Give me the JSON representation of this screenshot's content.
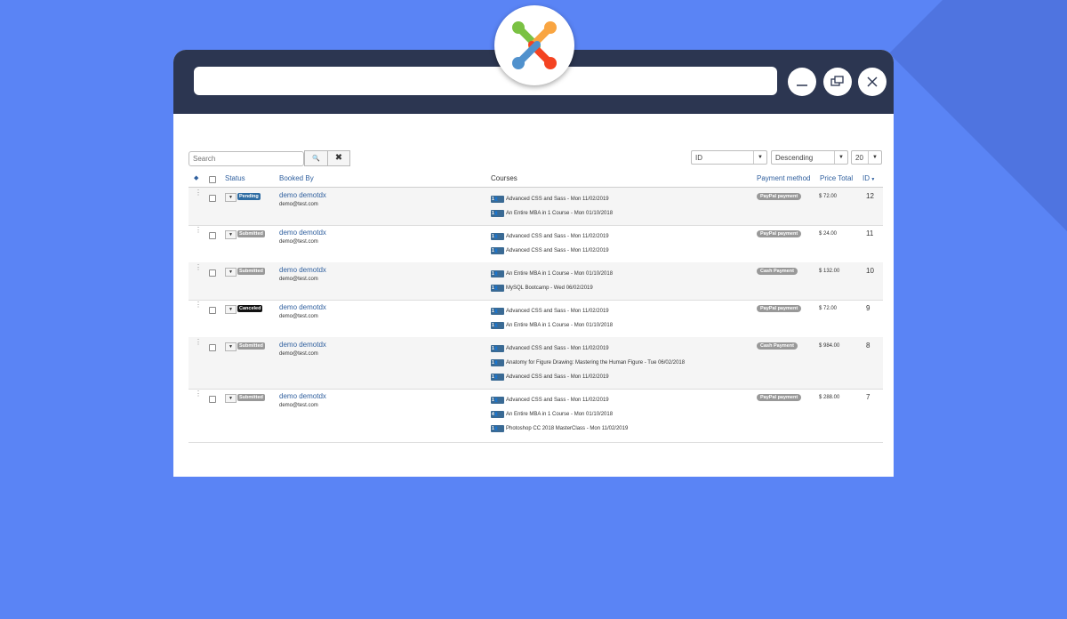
{
  "search": {
    "placeholder": "Search",
    "search_button": "🔍",
    "clear_button": "✖"
  },
  "sort": {
    "field": "ID",
    "direction": "Descending",
    "limit": "20"
  },
  "columns": {
    "status": "Status",
    "booked_by": "Booked By",
    "courses": "Courses",
    "payment_method": "Payment method",
    "price_total": "Price Total",
    "id": "ID"
  },
  "colors": {
    "pending": "#2f6da3",
    "submitted": "#999999",
    "canceled": "#111111",
    "link": "#2f5f9e",
    "titlebar": "#2c3651",
    "background": "#5a84f5"
  },
  "rows": [
    {
      "status": "Pending",
      "status_color": "#2f6da3",
      "name": "demo demotdx",
      "email": "demo@test.com",
      "courses": [
        {
          "qty": "1",
          "title": "Advanced CSS and Sass - Mon 11/02/2019"
        },
        {
          "qty": "1",
          "title": "An Entire MBA in 1 Course - Mon 01/10/2018"
        }
      ],
      "payment": "PayPal payment",
      "price": "$ 72.00",
      "id": "12"
    },
    {
      "status": "Submitted",
      "status_color": "#999999",
      "name": "demo demotdx",
      "email": "demo@test.com",
      "courses": [
        {
          "qty": "1",
          "title": "Advanced CSS and Sass - Mon 11/02/2019"
        },
        {
          "qty": "1",
          "title": "Advanced CSS and Sass - Mon 11/02/2019"
        }
      ],
      "payment": "PayPal payment",
      "price": "$ 24.00",
      "id": "11"
    },
    {
      "status": "Submitted",
      "status_color": "#999999",
      "name": "demo demotdx",
      "email": "demo@test.com",
      "courses": [
        {
          "qty": "1",
          "title": "An Entire MBA in 1 Course - Mon 01/10/2018"
        },
        {
          "qty": "1",
          "title": "MySQL Bootcamp - Wed 06/02/2019"
        }
      ],
      "payment": "Cash Payment",
      "price": "$ 132.00",
      "id": "10"
    },
    {
      "status": "Canceled",
      "status_color": "#111111",
      "name": "demo demotdx",
      "email": "demo@test.com",
      "courses": [
        {
          "qty": "1",
          "title": "Advanced CSS and Sass - Mon 11/02/2019"
        },
        {
          "qty": "1",
          "title": "An Entire MBA in 1 Course - Mon 01/10/2018"
        }
      ],
      "payment": "PayPal payment",
      "price": "$ 72.00",
      "id": "9"
    },
    {
      "status": "Submitted",
      "status_color": "#999999",
      "name": "demo demotdx",
      "email": "demo@test.com",
      "courses": [
        {
          "qty": "1",
          "title": "Advanced CSS and Sass - Mon 11/02/2019"
        },
        {
          "qty": "1",
          "title": "Anatomy for Figure Drawing: Mastering the Human Figure - Tue 06/02/2018"
        },
        {
          "qty": "1",
          "title": "Advanced CSS and Sass - Mon 11/02/2019"
        }
      ],
      "payment": "Cash Payment",
      "price": "$ 984.00",
      "id": "8"
    },
    {
      "status": "Submitted",
      "status_color": "#999999",
      "name": "demo demotdx",
      "email": "demo@test.com",
      "courses": [
        {
          "qty": "1",
          "title": "Advanced CSS and Sass - Mon 11/02/2019"
        },
        {
          "qty": "4",
          "title": "An Entire MBA in 1 Course - Mon 01/10/2018"
        },
        {
          "qty": "1",
          "title": "Photoshop CC 2018 MasterClass - Mon 11/02/2019"
        }
      ],
      "payment": "PayPal payment",
      "price": "$ 288.00",
      "id": "7"
    }
  ]
}
